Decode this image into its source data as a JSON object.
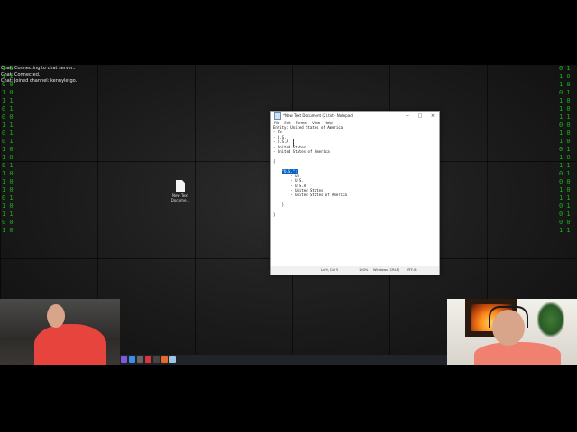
{
  "chat_overlay": {
    "lines": [
      "Chat: Connecting to chat server..",
      "Chat: Connected.",
      "Chat: Joined channel: kennyletgo."
    ]
  },
  "desktop": {
    "icon_label_line1": "New Text",
    "icon_label_line2": "Docume..."
  },
  "notepad": {
    "title": "*New Text Document (2).txt - Notepad",
    "menu": [
      "File",
      "Edit",
      "Format",
      "View",
      "Help"
    ],
    "lines": [
      "Entity: United States of America",
      "- US",
      "- U.S.",
      "- U.S.A",
      "- United States",
      "- United States of America",
      "",
      "{",
      "",
      "",
      "        - US",
      "        - U.S.",
      "        - U.S.A",
      "        - United States",
      "        - United States of America",
      "",
      "    }",
      "",
      "}"
    ],
    "selected_text": "\"U.S.\":",
    "status": {
      "position": "Ln 9, Col 5",
      "zoom": "100%",
      "line_ending": "Windows (CRLF)",
      "encoding": "UTF-8"
    }
  },
  "colors": {
    "matrix_green": "#19c419",
    "selection": "#0a64c8"
  }
}
